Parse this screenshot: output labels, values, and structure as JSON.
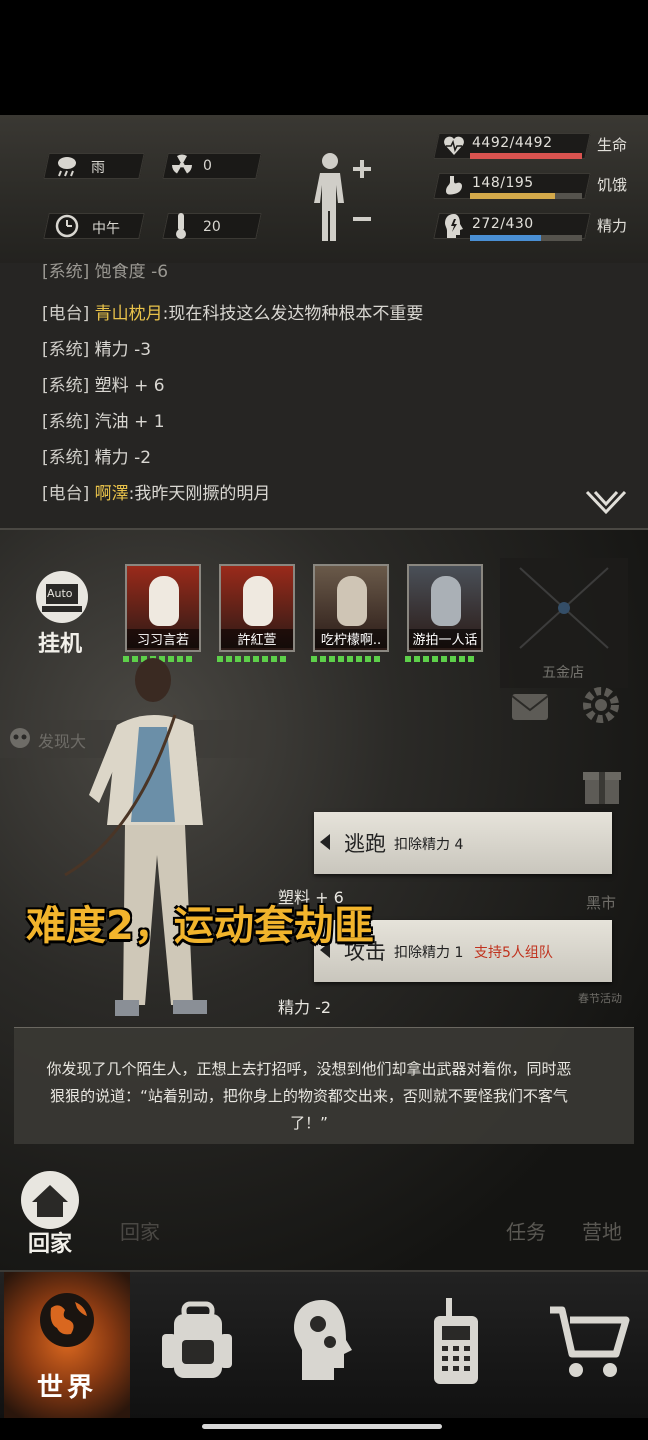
{
  "status": {
    "weather": "雨",
    "radiation": "0",
    "time_of_day": "中午",
    "temperature": "20",
    "life": {
      "value": "4492/4492",
      "label": "生命",
      "fraction": 1.0,
      "color": "#d9534f"
    },
    "hunger": {
      "value": "148/195",
      "label": "饥饿",
      "fraction": 0.76,
      "color": "#d4a94a"
    },
    "energy": {
      "value": "272/430",
      "label": "精力",
      "fraction": 0.63,
      "color": "#4a8fd4"
    }
  },
  "log": {
    "partial_top": "[系统] 饱食度 -6",
    "lines": [
      {
        "tag": "[电台]",
        "name": "青山枕月",
        "text": ":现在科技这么发达物种根本不重要"
      },
      {
        "tag": "[系统]",
        "name": "",
        "text": "精力 -3"
      },
      {
        "tag": "[系统]",
        "name": "",
        "text": "塑料 + 6"
      },
      {
        "tag": "[系统]",
        "name": "",
        "text": "汽油 + 1"
      },
      {
        "tag": "[系统]",
        "name": "",
        "text": "精力 -2"
      },
      {
        "tag": "[电台]",
        "name": "啊澤",
        "text": ":我昨天刚撅的明月"
      }
    ]
  },
  "auto_button": {
    "icon_text": "Auto",
    "label": "挂机"
  },
  "enemies": [
    {
      "name": "习习言若"
    },
    {
      "name": "許紅萱"
    },
    {
      "name": "吃柠檬啊.."
    },
    {
      "name": "游拍一人话"
    }
  ],
  "side_store_label": "五金店",
  "faded_notice": "发现大",
  "actions": {
    "flee": {
      "label": "逃跑",
      "cost": "扣除精力 4"
    },
    "attack": {
      "label": "攻击",
      "cost": "扣除精力 1",
      "extra": "支持5人组队"
    }
  },
  "floating_texts": {
    "plastic": "塑料 + 6",
    "energy": "精力 -2"
  },
  "side_labels": {
    "black_market": "黑市",
    "spring_event": "春节活动",
    "home_faded": "回家",
    "task": "任务",
    "camp": "营地"
  },
  "caption": "难度2，运动套劫匪",
  "dialog": "你发现了几个陌生人，正想上去打招呼，没想到他们却拿出武器对着你，同时恶狠狠的说道：“站着别动，把你身上的物资都交出来，否则就不要怪我们不客气了！”",
  "home_button": "回家",
  "nav": {
    "world": "世界"
  }
}
